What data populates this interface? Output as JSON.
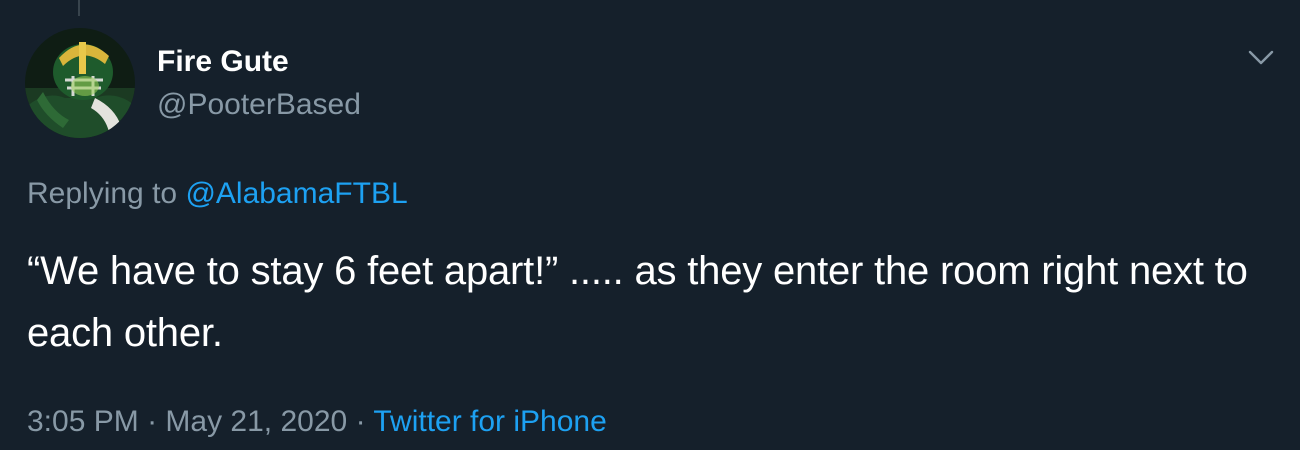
{
  "tweet": {
    "author": {
      "display_name": "Fire Gute",
      "handle": "@PooterBased",
      "avatar_icon": "avatar-helmet-image"
    },
    "replying_to_label": "Replying to",
    "replying_to_handle": "@AlabamaFTBL",
    "text": "“We have to stay 6 feet apart!” ..... as they enter the room right next to each other.",
    "time": "3:05 PM",
    "separator": "·",
    "date": "May 21, 2020",
    "source": "Twitter for iPhone",
    "menu_icon": "chevron-down-icon"
  },
  "colors": {
    "background": "#15202b",
    "text_primary": "#ffffff",
    "text_secondary": "#8899a6",
    "link": "#1da1f2",
    "thread_line": "#38444d"
  }
}
